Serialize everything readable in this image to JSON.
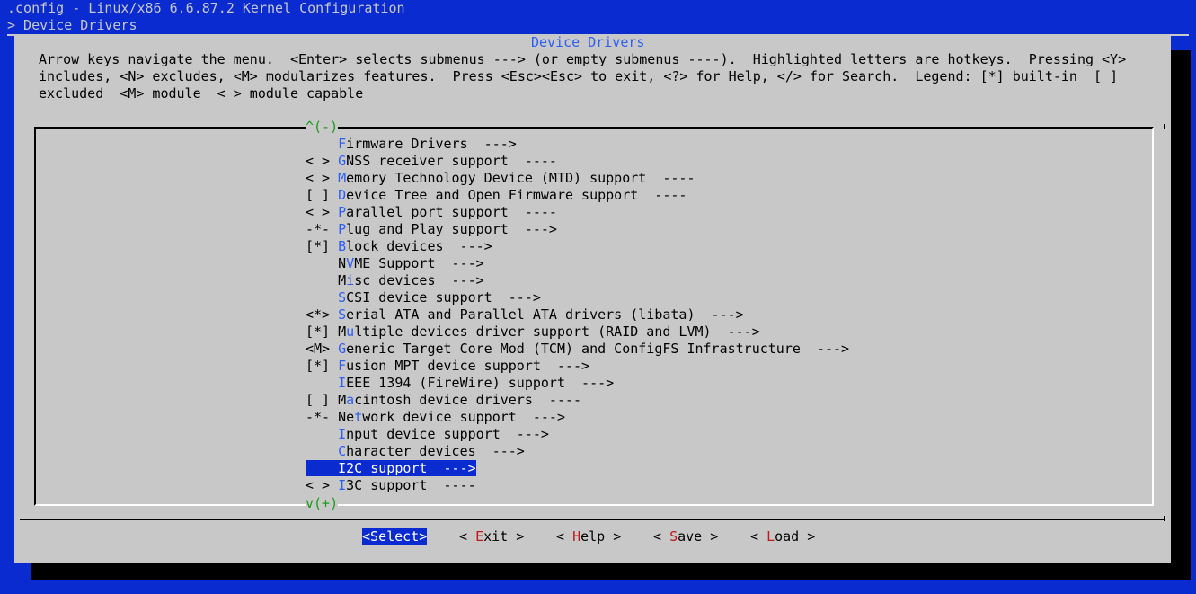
{
  "window": {
    "title": ".config - Linux/x86 6.6.87.2 Kernel Configuration",
    "breadcrumb": "> Device Drivers"
  },
  "dialog": {
    "title": "Device Drivers",
    "help_lines": [
      "Arrow keys navigate the menu.  <Enter> selects submenus ---> (or empty submenus ----).  Highlighted letters are hotkeys.  Pressing <Y>",
      "includes, <N> excludes, <M> modularizes features.  Press <Esc><Esc> to exit, <?> for Help, </> for Search.  Legend: [*] built-in  [ ]",
      "excluded  <M> module  < > module capable"
    ],
    "scroll_up": "^(-)",
    "scroll_down": "v(+)"
  },
  "menu": [
    {
      "state": "   ",
      "hotkey": "F",
      "rest": "irmware Drivers  --->"
    },
    {
      "state": "< >",
      "hotkey": "G",
      "rest": "NSS receiver support  ----"
    },
    {
      "state": "< >",
      "hotkey": "M",
      "rest": "emory Technology Device (MTD) support  ----"
    },
    {
      "state": "[ ]",
      "hotkey": "D",
      "rest": "evice Tree and Open Firmware support  ----"
    },
    {
      "state": "< >",
      "hotkey": "P",
      "rest": "arallel port support  ----"
    },
    {
      "state": "-*-",
      "hotkey": "P",
      "rest": "lug and Play support  --->"
    },
    {
      "state": "[*]",
      "hotkey": "B",
      "rest": "lock devices  --->"
    },
    {
      "state": "   ",
      "pre": "N",
      "hotkey": "V",
      "rest": "ME Support  --->"
    },
    {
      "state": "   ",
      "pre": "M",
      "hotkey": "i",
      "rest": "sc devices  --->"
    },
    {
      "state": "   ",
      "hotkey": "S",
      "rest": "CSI device support  --->"
    },
    {
      "state": "<*>",
      "hotkey": "S",
      "rest": "erial ATA and Parallel ATA drivers (libata)  --->"
    },
    {
      "state": "[*]",
      "pre": "M",
      "hotkey": "u",
      "rest": "ltiple devices driver support (RAID and LVM)  --->"
    },
    {
      "state": "<M>",
      "hotkey": "G",
      "rest": "eneric Target Core Mod (TCM) and ConfigFS Infrastructure  --->"
    },
    {
      "state": "[*]",
      "hotkey": "F",
      "rest": "usion MPT device support  --->"
    },
    {
      "state": "   ",
      "hotkey": "I",
      "rest": "EEE 1394 (FireWire) support  --->"
    },
    {
      "state": "[ ]",
      "pre": "M",
      "hotkey": "a",
      "rest": "cintosh device drivers  ----"
    },
    {
      "state": "-*-",
      "pre": "Ne",
      "hotkey": "t",
      "rest": "work device support  --->"
    },
    {
      "state": "   ",
      "hotkey": "I",
      "rest": "nput device support  --->"
    },
    {
      "state": "   ",
      "hotkey": "C",
      "rest": "haracter devices  --->"
    },
    {
      "state": "   ",
      "hotkey": "I",
      "rest": "2C support  --->",
      "selected": true
    },
    {
      "state": "< >",
      "hotkey": "I",
      "rest": "3C support  ----"
    }
  ],
  "buttons": [
    {
      "open": "<",
      "hotkey": "S",
      "rest": "elect",
      "close": ">",
      "active": true
    },
    {
      "open": "< ",
      "hotkey": "E",
      "rest": "xit",
      "close": " >"
    },
    {
      "open": "< ",
      "hotkey": "H",
      "rest": "elp",
      "close": " >"
    },
    {
      "open": "< ",
      "hotkey": "S",
      "rest": "ave",
      "close": " >"
    },
    {
      "open": "< ",
      "hotkey": "L",
      "rest": "oad",
      "close": " >"
    }
  ],
  "colors": {
    "background": "#0a2bd0",
    "dialog": "#c8c8c8",
    "hotkey": "#2d5ef5",
    "button_hotkey": "#c01818",
    "scroll_indicator": "#1a9c1a",
    "selection": "#0a2bd0"
  }
}
